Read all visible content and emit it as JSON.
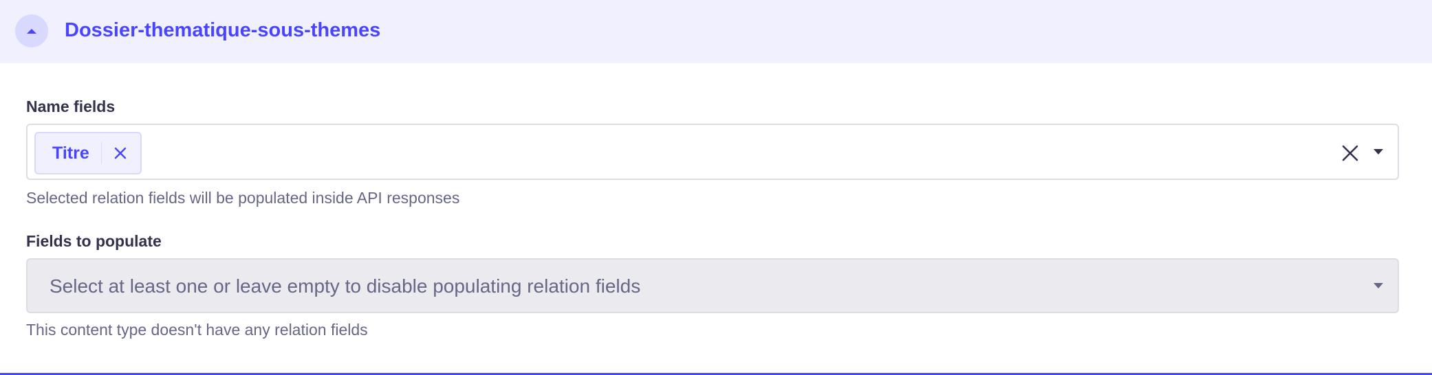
{
  "accordion": {
    "title": "Dossier-thematique-sous-themes",
    "toggle_icon": "chevron-up-icon",
    "accent_color": "#4945ff",
    "header_bg": "#f0f0ff"
  },
  "name_fields": {
    "label": "Name fields",
    "selected_tags": [
      {
        "label": "Titre",
        "remove_icon": "close-icon"
      }
    ],
    "clear_icon": "close-icon",
    "dropdown_icon": "caret-down-icon",
    "hint": "Selected relation fields will be populated inside API responses"
  },
  "fields_to_populate": {
    "label": "Fields to populate",
    "placeholder": "Select at least one or leave empty to disable populating relation fields",
    "dropdown_icon": "caret-down-icon",
    "disabled": true,
    "hint": "This content type doesn't have any relation fields"
  }
}
